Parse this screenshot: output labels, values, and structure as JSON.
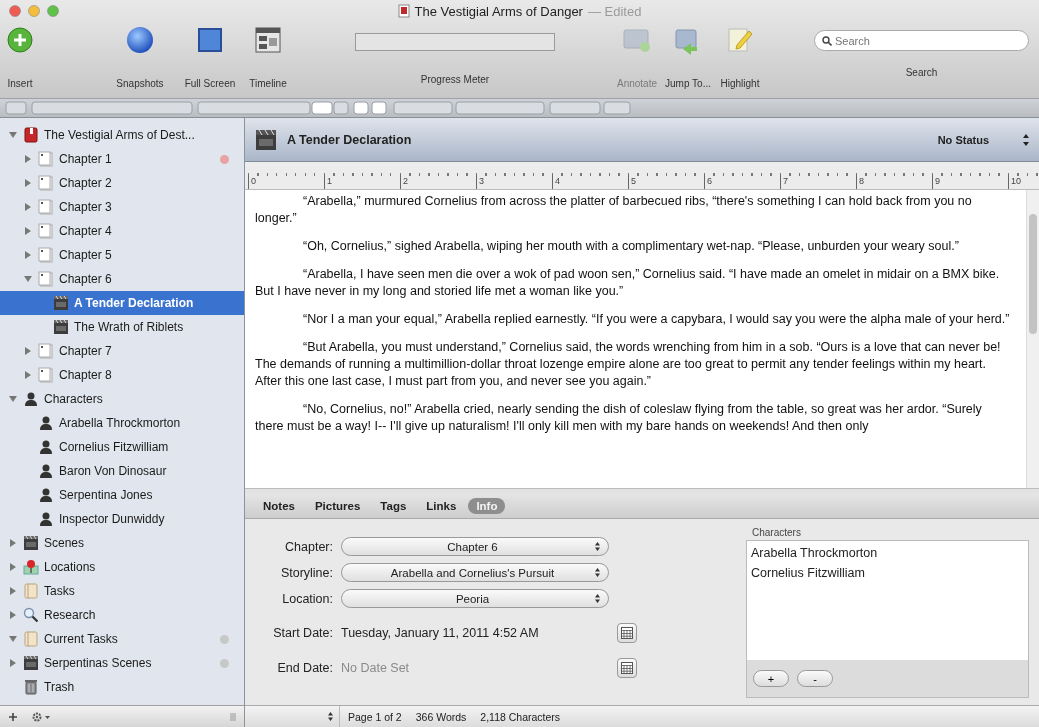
{
  "window": {
    "title": "The Vestigial Arms of Danger",
    "edited": "— Edited"
  },
  "toolbar": [
    {
      "kind": "insert",
      "label": "Insert",
      "disabled": false
    },
    {
      "kind": "snapshots",
      "label": "Snapshots",
      "disabled": false
    },
    {
      "kind": "fullscreen",
      "label": "Full Screen",
      "disabled": false
    },
    {
      "kind": "timeline",
      "label": "Timeline",
      "disabled": false
    },
    {
      "kind": "meter",
      "label": "Progress Meter",
      "level": 0
    },
    {
      "kind": "annotate",
      "label": "Annotate",
      "disabled": true
    },
    {
      "kind": "jump",
      "label": "Jump To...",
      "disabled": false
    },
    {
      "kind": "highlight",
      "label": "Highlight",
      "disabled": false
    },
    {
      "kind": "search",
      "label": "Search",
      "placeholder": "Search"
    }
  ],
  "binder": {
    "items": [
      {
        "kind": "project",
        "label": "The Vestigial Arms of Dest...",
        "expanded": true,
        "selected": false,
        "children": [
          {
            "kind": "chapter",
            "label": "Chapter 1",
            "expanded": false,
            "selected": false,
            "color": "#e8a4a4"
          },
          {
            "kind": "chapter",
            "label": "Chapter 2",
            "expanded": false,
            "selected": false
          },
          {
            "kind": "chapter",
            "label": "Chapter 3",
            "expanded": false,
            "selected": false
          },
          {
            "kind": "chapter",
            "label": "Chapter 4",
            "expanded": false,
            "selected": false
          },
          {
            "kind": "chapter",
            "label": "Chapter 5",
            "expanded": false,
            "selected": false
          },
          {
            "kind": "chapter",
            "label": "Chapter 6",
            "expanded": true,
            "selected": false,
            "children": [
              {
                "kind": "scene",
                "label": "A Tender Declaration",
                "selected": true
              },
              {
                "kind": "scene",
                "label": "The Wrath of Riblets",
                "selected": false
              }
            ]
          },
          {
            "kind": "chapter",
            "label": "Chapter 7",
            "expanded": false,
            "selected": false
          },
          {
            "kind": "chapter",
            "label": "Chapter 8",
            "expanded": false,
            "selected": false
          }
        ]
      },
      {
        "kind": "character",
        "label": "Characters",
        "expanded": true,
        "selected": false,
        "children": [
          {
            "kind": "character",
            "label": "Arabella Throckmorton",
            "selected": false
          },
          {
            "kind": "character",
            "label": "Cornelius Fitzwilliam",
            "selected": false
          },
          {
            "kind": "character",
            "label": "Baron Von Dinosaur",
            "selected": false
          },
          {
            "kind": "character",
            "label": "Serpentina Jones",
            "selected": false
          },
          {
            "kind": "character",
            "label": "Inspector Dunwiddy",
            "selected": false
          }
        ]
      },
      {
        "kind": "scenes",
        "label": "Scenes",
        "expanded": false,
        "selected": false
      },
      {
        "kind": "location",
        "label": "Locations",
        "expanded": false,
        "selected": false
      },
      {
        "kind": "tasks",
        "label": "Tasks",
        "expanded": false,
        "selected": false
      },
      {
        "kind": "research",
        "label": "Research",
        "expanded": false,
        "selected": false
      },
      {
        "kind": "tasks",
        "label": "Current Tasks",
        "expanded": true,
        "selected": false,
        "color": "#c8c8c8"
      },
      {
        "kind": "scenes",
        "label": "Serpentinas Scenes",
        "expanded": false,
        "selected": false,
        "color": "#c8c8c8"
      },
      {
        "kind": "trash",
        "label": "Trash",
        "selected": false
      }
    ]
  },
  "editor": {
    "title": "A Tender Declaration",
    "status": "No Status",
    "ruler": [
      "0",
      "1",
      "2",
      "3",
      "4",
      "5",
      "6",
      "7",
      "8",
      "9",
      "10"
    ],
    "paragraphs": [
      "“Arabella,” murmured Cornelius from across the platter of barbecued ribs, “there's something I can hold back from you no longer.”",
      "“Oh, Cornelius,” sighed Arabella, wiping her mouth with a complimentary wet-nap. “Please, unburden your weary soul.”",
      "“Arabella, I have seen men die over a wok of pad woon sen,” Cornelius said. “I have made an omelet in midair on a BMX bike. But I have never in my long and storied life met a woman like you.”",
      "“Nor I a man your equal,” Arabella replied earnestly. “If you were a capybara, I would say you were the alpha male of your herd.”",
      "“But Arabella, you must understand,” Cornelius said, the words wrenching from him in a sob. “Ours is a love that can never be! The demands of running a multimillion-dollar throat lozenge empire alone are too great to permit any tender feelings within my heart. After this one last case, I must part from you, and never see you again.”",
      "“No, Cornelius, no!” Arabella cried, nearly sending the dish of coleslaw flying from the table, so great was her ardor. “Surely there must be a way! I-- I'll give up naturalism! I'll only kill men with my bare hands on weekends! And then only"
    ]
  },
  "inspector": {
    "tabs": [
      {
        "label": "Notes",
        "selected": false
      },
      {
        "label": "Pictures",
        "selected": false
      },
      {
        "label": "Tags",
        "selected": false
      },
      {
        "label": "Links",
        "selected": false
      },
      {
        "label": "Info",
        "selected": true
      }
    ],
    "fields": [
      {
        "kind": "select",
        "label": "Chapter:",
        "value": "Chapter 6"
      },
      {
        "kind": "select",
        "label": "Storyline:",
        "value": "Arabella and Cornelius's Pursuit"
      },
      {
        "kind": "select",
        "label": "Location:",
        "value": "Peoria"
      },
      {
        "kind": "date",
        "label": "Start Date:",
        "value": "Tuesday, January 11, 2011 4:52 AM"
      },
      {
        "kind": "date",
        "label": "End Date:",
        "placeholder": "No Date Set"
      }
    ],
    "characters": {
      "title": "Characters",
      "items": [
        "Arabella Throckmorton",
        "Cornelius Fitzwilliam"
      ],
      "buttons": [
        "+",
        "-"
      ]
    }
  },
  "status_bar": [
    "Page 1 of 2",
    "366 Words",
    "2,118 Characters"
  ]
}
